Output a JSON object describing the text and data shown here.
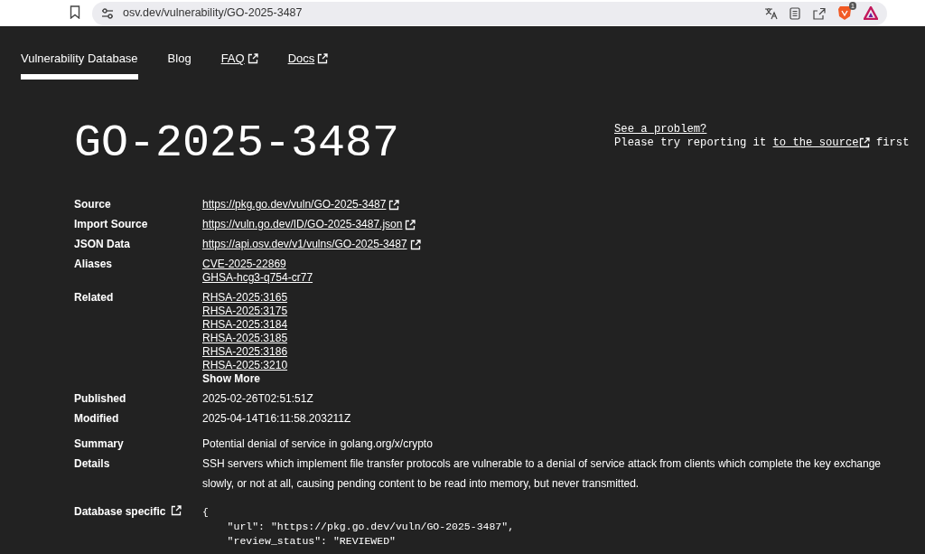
{
  "browser": {
    "address": "osv.dev/vulnerability/GO-2025-3487",
    "extension_badge": "1"
  },
  "nav": [
    {
      "label": "Vulnerability Database",
      "selected": true,
      "external": false
    },
    {
      "label": "Blog",
      "selected": false,
      "external": false
    },
    {
      "label": "FAQ",
      "selected": false,
      "external": true
    },
    {
      "label": "Docs",
      "selected": false,
      "external": true
    }
  ],
  "title": "GO-2025-3487",
  "report": {
    "link": "See a problem?",
    "text_before": "Please try reporting it",
    "source_link": "to the source",
    "text_after": "first"
  },
  "sections": [
    [
      {
        "label": "Source",
        "kind": "links",
        "external": true,
        "items": [
          "https://pkg.go.dev/vuln/GO-2025-3487"
        ]
      },
      {
        "label": "Import Source",
        "kind": "links",
        "external": true,
        "items": [
          "https://vuln.go.dev/ID/GO-2025-3487.json"
        ]
      },
      {
        "label": "JSON Data",
        "kind": "links",
        "external": true,
        "items": [
          "https://api.osv.dev/v1/vulns/GO-2025-3487"
        ]
      },
      {
        "label": "Aliases",
        "kind": "links",
        "external": false,
        "items": [
          "CVE-2025-22869",
          "GHSA-hcg3-q754-cr77"
        ]
      },
      {
        "label": "Related",
        "kind": "links",
        "external": false,
        "items": [
          "RHSA-2025:3165",
          "RHSA-2025:3175",
          "RHSA-2025:3184",
          "RHSA-2025:3185",
          "RHSA-2025:3186",
          "RHSA-2025:3210"
        ],
        "more": "Show More"
      },
      {
        "label": "Published",
        "kind": "text",
        "items": [
          "2025-02-26T02:51:51Z"
        ]
      },
      {
        "label": "Modified",
        "kind": "text",
        "items": [
          "2025-04-14T16:11:58.203211Z"
        ]
      }
    ],
    [
      {
        "label": "Summary",
        "kind": "text",
        "items": [
          "Potential denial of service in golang.org/x/crypto"
        ]
      },
      {
        "label": "Details",
        "kind": "paragraph",
        "items": [
          "SSH servers which implement file transfer protocols are vulnerable to a denial of service attack from clients which complete the key exchange slowly, or not at all, causing pending content to be read into memory, but never transmitted."
        ]
      }
    ],
    [
      {
        "label": "Database specific",
        "label_external": true,
        "kind": "code",
        "items": [
          "{",
          "    \"url\": \"https://pkg.go.dev/vuln/GO-2025-3487\",",
          "    \"review_status\": \"REVIEWED\""
        ]
      }
    ]
  ]
}
